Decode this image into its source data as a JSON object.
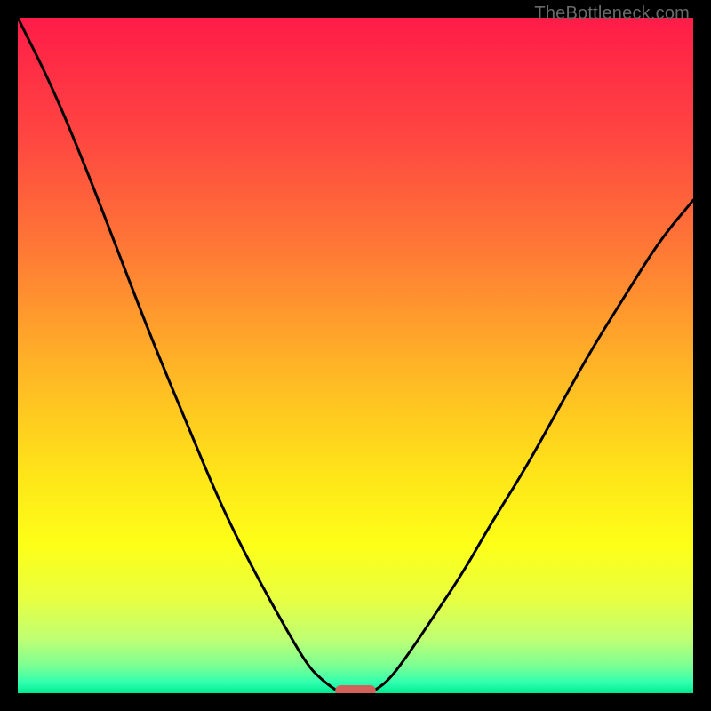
{
  "watermark": "TheBottleneck.com",
  "chart_data": {
    "type": "line",
    "title": "",
    "xlabel": "",
    "ylabel": "",
    "xlim": [
      0,
      100
    ],
    "ylim": [
      0,
      100
    ],
    "grid": false,
    "legend": false,
    "series": [
      {
        "name": "left-curve",
        "x": [
          0,
          5,
          10,
          15,
          20,
          25,
          30,
          35,
          40,
          43,
          45,
          47,
          48
        ],
        "values": [
          100,
          90,
          78,
          65,
          52,
          40,
          28,
          18,
          9,
          4,
          2,
          0.5,
          0
        ]
      },
      {
        "name": "right-curve",
        "x": [
          52,
          53,
          55,
          58,
          62,
          66,
          70,
          75,
          80,
          85,
          90,
          95,
          100
        ],
        "values": [
          0,
          0.5,
          2,
          6,
          12,
          18,
          25,
          33,
          42,
          51,
          59,
          67,
          73
        ]
      }
    ],
    "marker": {
      "name": "minimum-marker",
      "x_center": 50,
      "width": 6,
      "y": 0,
      "color": "#d2605b"
    },
    "gradient_stops": [
      {
        "offset": 0.0,
        "color": "#ff1c48"
      },
      {
        "offset": 0.18,
        "color": "#ff4741"
      },
      {
        "offset": 0.35,
        "color": "#ff7b35"
      },
      {
        "offset": 0.52,
        "color": "#ffb526"
      },
      {
        "offset": 0.67,
        "color": "#ffe319"
      },
      {
        "offset": 0.78,
        "color": "#fdff17"
      },
      {
        "offset": 0.86,
        "color": "#e8ff41"
      },
      {
        "offset": 0.92,
        "color": "#bfff73"
      },
      {
        "offset": 0.96,
        "color": "#7bff94"
      },
      {
        "offset": 0.985,
        "color": "#2dffb0"
      },
      {
        "offset": 1.0,
        "color": "#00e98e"
      }
    ]
  }
}
